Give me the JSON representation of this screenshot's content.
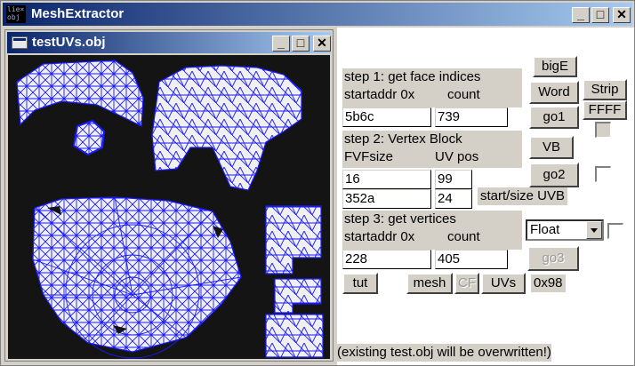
{
  "app": {
    "icon_text": "lie×\nobj",
    "title": "MeshExtractor"
  },
  "window_buttons": {
    "minimize": "_",
    "maximize": "□",
    "close": "✕"
  },
  "child_window": {
    "title": "testUVs.obj"
  },
  "step1": {
    "heading": "step 1: get face indices",
    "startaddr_label": "startaddr 0x",
    "count_label": "count",
    "startaddr_value": "5b6c",
    "count_value": "739"
  },
  "step2": {
    "heading": "step 2: Vertex Block",
    "fvfsize_label": "FVFsize",
    "uvpos_label": "UV pos",
    "fvfsize_value": "16",
    "uvpos_value": "99",
    "start_value": "352a",
    "size_value": "24",
    "start_size_label": "start/size UVB"
  },
  "step3": {
    "heading": "step 3: get vertices",
    "startaddr_label": "startaddr 0x",
    "count_label": "count",
    "startaddr_value": "228",
    "count_value": "405"
  },
  "buttons": {
    "bigE": "bigE",
    "word": "Word",
    "strip": "Strip",
    "ffff": "FFFF",
    "go1": "go1",
    "vb": "VB",
    "go2": "go2",
    "go3": "go3",
    "tut": "tut",
    "mesh": "mesh",
    "cf": "CF",
    "uvs": "UVs"
  },
  "format_select": {
    "selected": "Float"
  },
  "hex_value": "0x98",
  "status": "(existing test.obj will be overwritten!)",
  "colors": {
    "titlebar_start": "#0a246a",
    "titlebar_end": "#a6caf0",
    "wire": "#1a1aff",
    "canvas": "#141414"
  }
}
